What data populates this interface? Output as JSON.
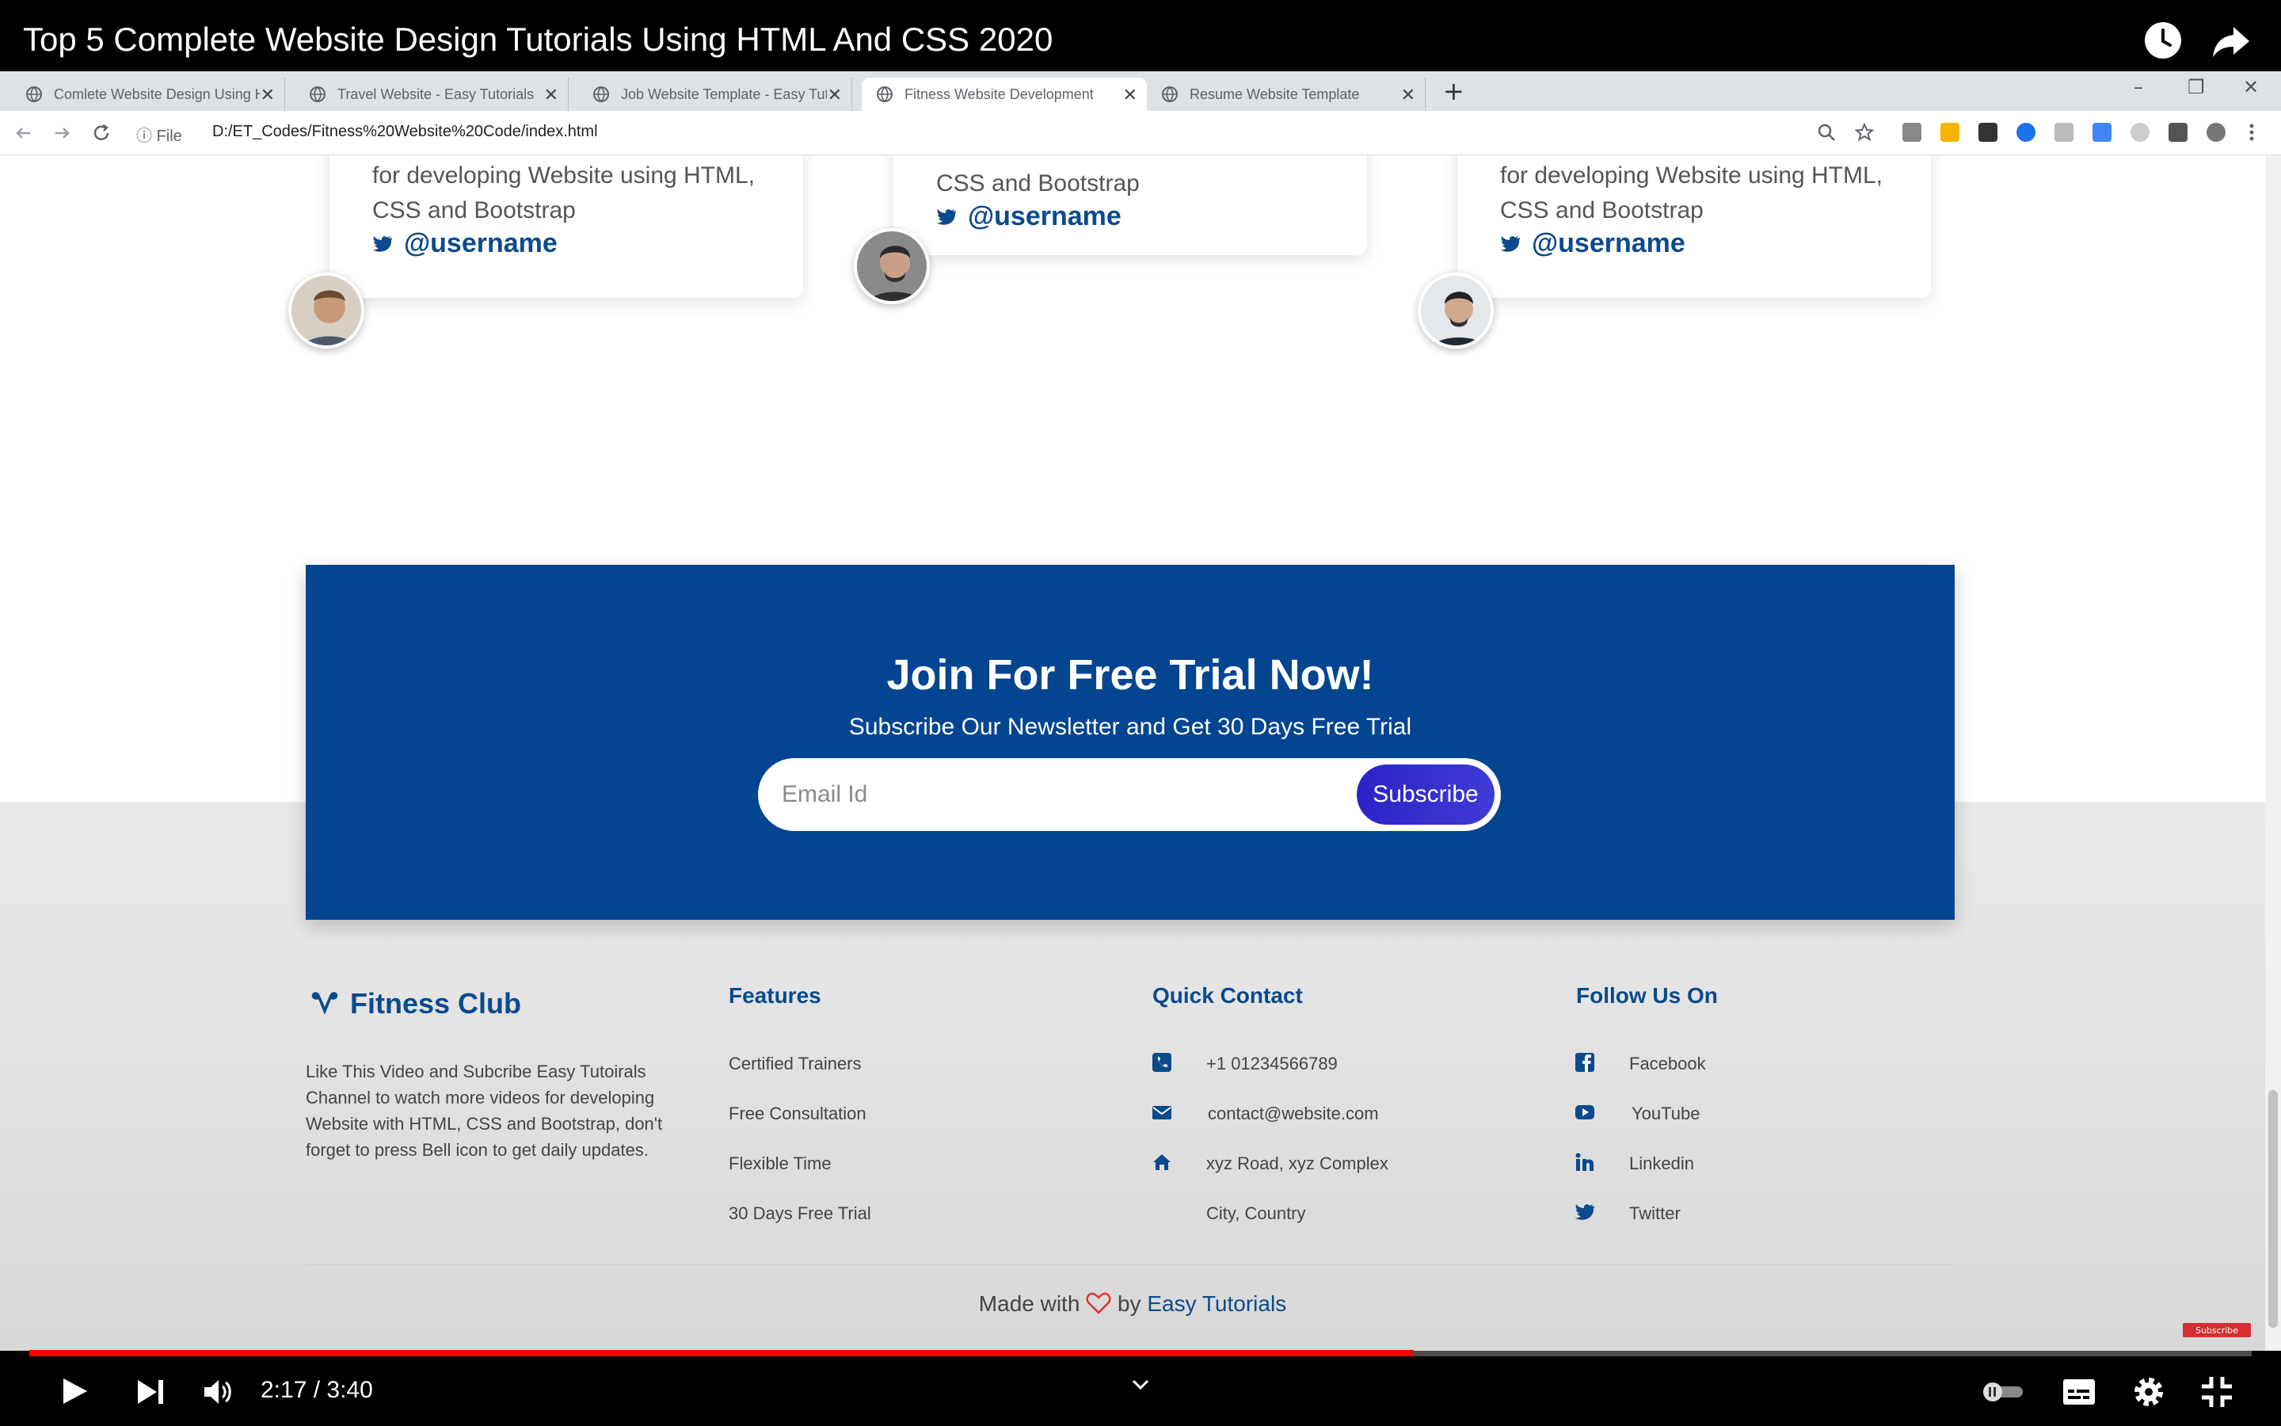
{
  "video": {
    "title": "Top 5 Complete Website Design Tutorials Using HTML And CSS 2020",
    "time_display": "2:17 / 3:40",
    "progress": 0.623,
    "subscribe_tag": "Subscribe"
  },
  "browser": {
    "tabs": [
      {
        "label": "Comlete Website Design Using H",
        "active": false
      },
      {
        "label": "Travel Website - Easy Tutorials",
        "active": false
      },
      {
        "label": "Job Website Template - Easy Tut",
        "active": false
      },
      {
        "label": "Fitness Website Development",
        "active": true
      },
      {
        "label": "Resume Website Template",
        "active": false
      }
    ],
    "url_prefix": "File",
    "url": "D:/ET_Codes/Fitness%20Website%20Code/index.html",
    "new_tab": "+"
  },
  "testimonials": [
    {
      "text_line1": "for developing Website using HTML,",
      "text_line2": "CSS and Bootstrap",
      "handle": "@username"
    },
    {
      "text_line1": "",
      "text_line2": "CSS and Bootstrap",
      "handle": "@username"
    },
    {
      "text_line1": "for developing Website using HTML,",
      "text_line2": "CSS and Bootstrap",
      "handle": "@username"
    }
  ],
  "trial": {
    "title": "Join For Free Trial Now!",
    "subtitle": "Subscribe Our Newsletter and Get 30 Days Free Trial",
    "email_placeholder": "Email Id",
    "button": "Subscribe"
  },
  "footer": {
    "brand": "Fitness Club",
    "description": "Like This Video and Subcribe Easy Tutoirals Channel to watch more videos for developing Website with HTML, CSS and Bootstrap, don't forget to press Bell icon to get daily updates.",
    "features": {
      "heading": "Features",
      "items": [
        "Certified Trainers",
        "Free Consultation",
        "Flexible Time",
        "30 Days Free Trial"
      ]
    },
    "contact": {
      "heading": "Quick Contact",
      "phone": "+1 01234566789",
      "email": "contact@website.com",
      "address_line1": "xyz Road, xyz Complex",
      "address_line2": "City, Country"
    },
    "social": {
      "heading": "Follow Us On",
      "items": [
        "Facebook",
        "YouTube",
        "Linkedin",
        "Twitter"
      ]
    },
    "made_with": "Made with",
    "by": "by",
    "author": "Easy Tutorials"
  },
  "colors": {
    "brand_blue": "#034590",
    "link_blue": "#0b4a8c",
    "progress_red": "#ff0000",
    "button_gradient": "#2a23c7"
  }
}
